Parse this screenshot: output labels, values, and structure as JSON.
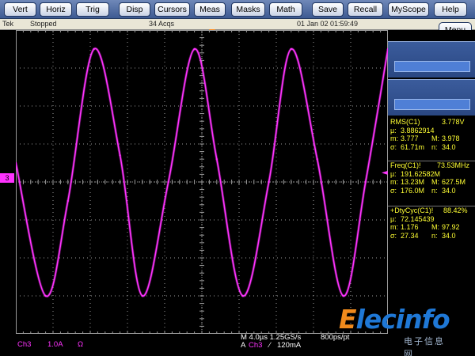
{
  "menubar": {
    "buttons": [
      "Vert",
      "Horiz",
      "Trig",
      "Disp",
      "Cursors",
      "Meas",
      "Masks",
      "Math",
      "Save",
      "Recall",
      "MyScope",
      "Help"
    ]
  },
  "status": {
    "brand": "Tek",
    "state": "Stopped",
    "acqs": "34 Acqs",
    "datetime": "01 Jan 02 01:59:49"
  },
  "menu_label": "Menu",
  "channel_marker": "3",
  "measurements": {
    "rms": {
      "title": "RMS(C1)",
      "value": "3.778V",
      "mu_label": "µ:",
      "mu": "3.8862914",
      "m_label": "m:",
      "m": "3.777",
      "M_label": "M:",
      "M": "3.978",
      "sigma_label": "σ:",
      "sigma": "61.71m",
      "n_label": "n:",
      "n": "34.0"
    },
    "freq": {
      "title": "Freq(C1)!",
      "value": "73.53MHz",
      "mu_label": "µ:",
      "mu": "191.62582M",
      "m_label": "m:",
      "m": "13.23M",
      "M_label": "M:",
      "M": "627.5M",
      "sigma_label": "σ:",
      "sigma": "176.0M",
      "n_label": "n:",
      "n": "34.0"
    },
    "duty": {
      "title": "+DtyCyc(C1)!",
      "value": "88.42%",
      "mu_label": "µ:",
      "mu": "72.145439",
      "m_label": "m:",
      "m": "1.176",
      "M_label": "M:",
      "M": "97.92",
      "sigma_label": "σ:",
      "sigma": "27.34",
      "n_label": "n:",
      "n": "34.0"
    }
  },
  "bottom": {
    "channel": "Ch3",
    "scale": "1.0A",
    "coupling": "Ω",
    "timebase": "M 4.0µs 1.25GS/s",
    "record": "800ps/pt",
    "trig_prefix": "A",
    "trig_channel": "Ch3",
    "trig_slope": "⁄",
    "trig_level": "120mA"
  },
  "watermark": {
    "logo_text": "Elecinfo",
    "sub_text": "电子信息网"
  },
  "colors": {
    "trace": "#ff33ff",
    "measurement_text": "#ffff33",
    "grid": "#9a9a9a",
    "menubar": "#4a66a0",
    "trigger_marker": "#ff8a1a"
  },
  "chart_data": {
    "type": "line",
    "x_divisions": 10,
    "y_divisions": 8,
    "series": [
      {
        "x": [
          -5.0,
          -4.2,
          -3.6,
          -2.9,
          -2.2,
          -1.6,
          -0.9,
          -0.2,
          0.4,
          1.1,
          1.8,
          2.4,
          3.1,
          3.8,
          4.4,
          5.0
        ],
        "y": [
          0.5,
          -3.0,
          -0.5,
          3.5,
          0.7,
          -3.0,
          0.0,
          3.5,
          0.6,
          -3.0,
          0.0,
          3.5,
          0.6,
          -3.0,
          0.0,
          3.5
        ]
      }
    ]
  }
}
